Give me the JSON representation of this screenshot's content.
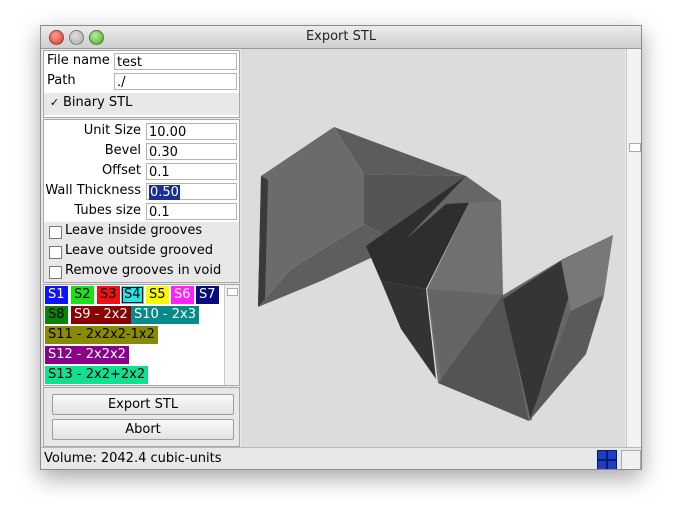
{
  "window": {
    "title": "Export STL"
  },
  "file": {
    "name_label": "File name",
    "name_value": "test",
    "path_label": "Path",
    "path_value": "./",
    "binary_label": "Binary STL",
    "binary_checked": true
  },
  "params": {
    "unit_size_label": "Unit Size",
    "unit_size_value": "10.00",
    "bevel_label": "Bevel",
    "bevel_value": "0.30",
    "offset_label": "Offset",
    "offset_value": "0.1",
    "wall_label": "Wall Thickness",
    "wall_value": "0.50",
    "tubes_label": "Tubes size",
    "tubes_value": "0.1",
    "leave_inside_label": "Leave inside grooves",
    "leave_inside_checked": false,
    "leave_outside_label": "Leave outside grooved",
    "leave_outside_checked": false,
    "remove_label": "Remove grooves in void",
    "remove_checked": false
  },
  "shapes": [
    {
      "label": "S1",
      "bg": "#0a14ff",
      "fg": "#ffffff"
    },
    {
      "label": "S2",
      "bg": "#17e317",
      "fg": "#000000"
    },
    {
      "label": "S3",
      "bg": "#f01010",
      "fg": "#000000"
    },
    {
      "label": "S4",
      "bg": "#22e6e6",
      "fg": "#000000",
      "active": true
    },
    {
      "label": "S5",
      "bg": "#fafa00",
      "fg": "#000000"
    },
    {
      "label": "S6",
      "bg": "#ff22ff",
      "fg": "#ffffff"
    },
    {
      "label": "S7",
      "bg": "#0a0a80",
      "fg": "#ffffff"
    },
    {
      "label": "S8",
      "bg": "#078407",
      "fg": "#000000"
    },
    {
      "label": "S9 - 2x2",
      "bg": "#8a0000",
      "fg": "#ffffff"
    },
    {
      "label": "S10 - 2x3",
      "bg": "#078a8a",
      "fg": "#ffffff"
    },
    {
      "label": "S11 - 2x2x2-1x2",
      "bg": "#8a8a00",
      "fg": "#000000"
    },
    {
      "label": "S12 - 2x2x2",
      "bg": "#8a008a",
      "fg": "#ffffff"
    },
    {
      "label": "S13 - 2x2+2x2",
      "bg": "#10e090",
      "fg": "#000000"
    }
  ],
  "buttons": {
    "export": "Export STL",
    "abort": "Abort"
  },
  "status": {
    "text": "Volume: 2042.4 cubic-units"
  }
}
